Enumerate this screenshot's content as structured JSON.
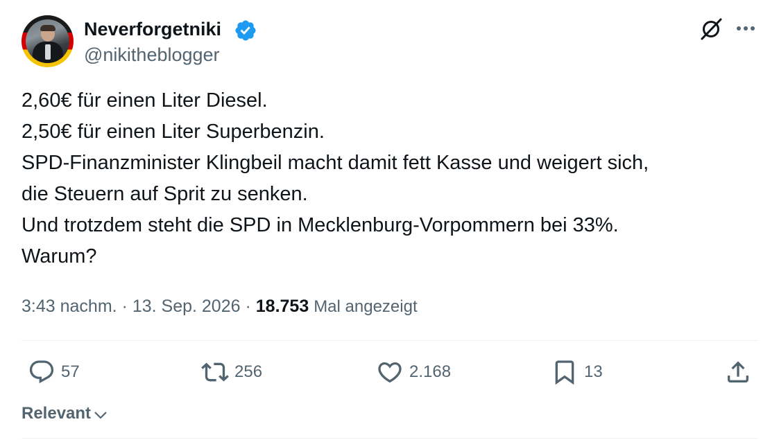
{
  "author": {
    "display_name": "Neverforgetniki",
    "handle": "@nikitheblogger",
    "verified": true,
    "avatar_border_colors": [
      "#1a1a1a",
      "#d40000",
      "#f5c400"
    ]
  },
  "tweet": {
    "lines": [
      "2,60€ für einen Liter Diesel.",
      "2,50€ für einen Liter Superbenzin.",
      "SPD-Finanzminister Klingbeil macht damit fett Kasse und weigert sich,",
      "die Steuern auf Sprit zu senken.",
      "Und trotzdem steht die SPD in Mecklenburg-Vorpommern bei 33%.",
      "Warum?"
    ],
    "time": "3:43 nachm.",
    "separator": "·",
    "date": "13. Sep. 2026",
    "views_count": "18.753",
    "views_label": "Mal angezeigt"
  },
  "actions": {
    "replies": "57",
    "reposts": "256",
    "likes": "2.168",
    "bookmarks": "13"
  },
  "icons": {
    "top_right": [
      "grok-icon",
      "more-icon"
    ],
    "actions": [
      "reply-icon",
      "repost-icon",
      "like-icon",
      "bookmark-icon",
      "share-icon"
    ]
  },
  "sort": {
    "label": "Relevant"
  },
  "colors": {
    "text": "#0f1419",
    "secondary": "#536471",
    "verified": "#1d9bf0",
    "divider": "#eff3f4"
  }
}
